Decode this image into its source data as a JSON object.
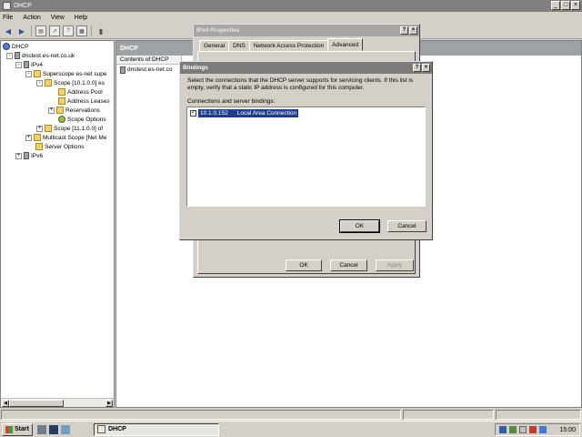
{
  "window": {
    "title": "DHCP"
  },
  "menu": {
    "items": [
      "File",
      "Action",
      "View",
      "Help"
    ]
  },
  "toolbar": {
    "icons": [
      "back-arrow-icon",
      "forward-arrow-icon",
      "show-tree-icon",
      "export-icon",
      "help-icon",
      "properties-icon",
      "server-icon"
    ]
  },
  "tree": {
    "items": [
      {
        "label": "DHCP",
        "icon": "dhcp-icon"
      },
      {
        "label": "dnstest.es-net.co.uk",
        "icon": "server-icon",
        "expander": "-"
      },
      {
        "label": "IPv4",
        "icon": "server-icon",
        "expander": "-"
      },
      {
        "label": "Superscope es-net supe",
        "icon": "folder-icon",
        "expander": "-"
      },
      {
        "label": "Scope [10.1.0.0] es",
        "icon": "folder-icon",
        "expander": "-"
      },
      {
        "label": "Address Pool",
        "icon": "folder-icon"
      },
      {
        "label": "Address Leases",
        "icon": "folder-icon"
      },
      {
        "label": "Reservations",
        "icon": "folder-icon",
        "expander": "+"
      },
      {
        "label": "Scope Options",
        "icon": "gear-icon"
      },
      {
        "label": "Scope [11.1.0.0] of",
        "icon": "folder-icon",
        "expander": "+"
      },
      {
        "label": "Multicast Scope [Net Me",
        "icon": "folder-icon",
        "expander": "+"
      },
      {
        "label": "Server Options",
        "icon": "folder-icon"
      },
      {
        "label": "IPv6",
        "icon": "server-icon",
        "expander": "+"
      }
    ]
  },
  "right_pane": {
    "header": "DHCP",
    "column": "Contents of DHCP",
    "rows": [
      "dnstest.es-net.co"
    ]
  },
  "ipv4_properties": {
    "title": "IPv4 Properties",
    "tabs": [
      "General",
      "DNS",
      "Network Access Protection",
      "Advanced"
    ],
    "active_tab": "Advanced",
    "buttons": {
      "ok": "OK",
      "cancel": "Cancel",
      "apply": "Apply"
    }
  },
  "bindings": {
    "title": "Bindings",
    "description": "Select the connections that the DHCP server supports for servicing clients. If this list is empty, verify that a static IP address is configured for this computer.",
    "list_label": "Connections and server bindings:",
    "connections": [
      {
        "checked": true,
        "address": "10.1.0.152",
        "name": "Local Area Connection"
      }
    ],
    "buttons": {
      "ok": "OK",
      "cancel": "Cancel"
    }
  },
  "taskbar": {
    "start": "Start",
    "task": "DHCP",
    "clock": "15:00"
  }
}
